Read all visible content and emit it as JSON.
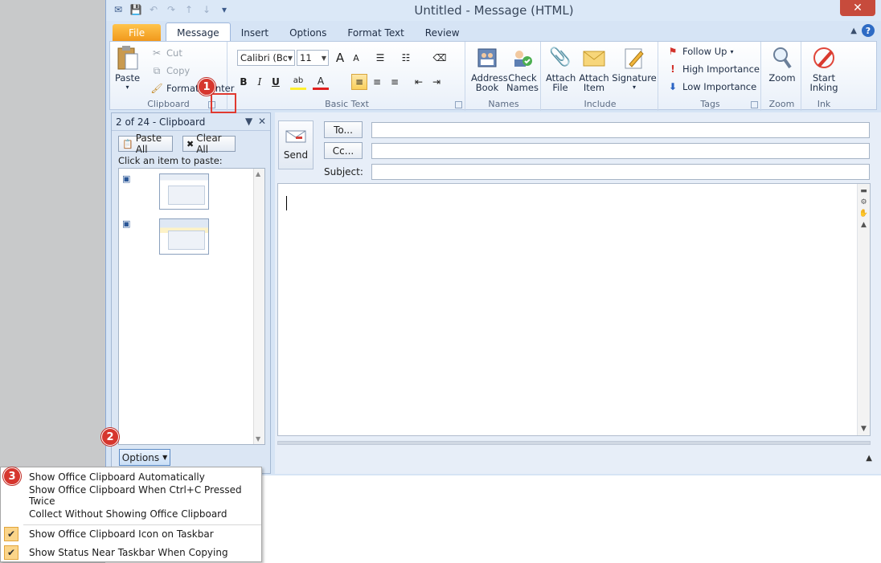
{
  "window": {
    "title": "Untitled - Message (HTML)",
    "close_glyph": "✕"
  },
  "qat": {
    "save_glyph": "💾",
    "undo_glyph": "↶",
    "redo_glyph": "↷",
    "up_glyph": "↑",
    "down_glyph": "↓",
    "more_glyph": "▾"
  },
  "tabs": [
    {
      "label": "File"
    },
    {
      "label": "Message"
    },
    {
      "label": "Insert"
    },
    {
      "label": "Options"
    },
    {
      "label": "Format Text"
    },
    {
      "label": "Review"
    }
  ],
  "ribbon": {
    "clipboard": {
      "label": "Clipboard",
      "paste": "Paste",
      "cut": "Cut",
      "copy": "Copy",
      "format_painter": "Format Painter"
    },
    "basic_text": {
      "label": "Basic Text",
      "font": "Calibri (Body)",
      "size": "11",
      "bold": "B",
      "italic": "I",
      "underline": "U",
      "grow": "A",
      "shrink": "A",
      "highlight": "ab",
      "font_color": "A"
    },
    "names": {
      "label": "Names",
      "address_book": "Address Book",
      "check_names": "Check Names"
    },
    "include": {
      "label": "Include",
      "attach_file": "Attach File",
      "attach_item": "Attach Item",
      "signature": "Signature"
    },
    "tags": {
      "label": "Tags",
      "follow_up": "Follow Up",
      "high": "High Importance",
      "low": "Low Importance"
    },
    "zoom": {
      "label": "Zoom",
      "zoom": "Zoom"
    },
    "ink": {
      "label": "Ink",
      "start_inking": "Start Inking"
    }
  },
  "clipboard_pane": {
    "title": "2 of 24 - Clipboard",
    "paste_all": "Paste All",
    "clear_all": "Clear All",
    "hint": "Click an item to paste:",
    "options": "Options"
  },
  "compose": {
    "send": "Send",
    "to": "To...",
    "cc": "Cc...",
    "subject_label": "Subject:",
    "to_value": "",
    "cc_value": "",
    "subject_value": ""
  },
  "options_menu": {
    "items": [
      {
        "label": "Show Office Clipboard Automatically",
        "checked": false
      },
      {
        "label": "Show Office Clipboard When Ctrl+C Pressed Twice",
        "checked": false
      },
      {
        "label": "Collect Without Showing Office Clipboard",
        "checked": false
      },
      {
        "label": "Show Office Clipboard Icon on Taskbar",
        "checked": true
      },
      {
        "label": "Show Status Near Taskbar When Copying",
        "checked": true
      }
    ],
    "check_glyph": "✔"
  },
  "callouts": {
    "one": "1",
    "two": "2",
    "three": "3"
  },
  "colors": {
    "accent": "#2b579a",
    "file_tab": "#f0961a",
    "callout": "#d6362e",
    "highlight": "#f9cf5c"
  }
}
